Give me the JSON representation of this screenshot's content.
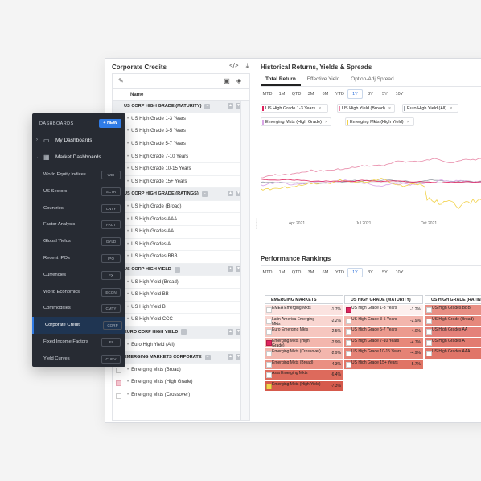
{
  "corporate_credits": {
    "title": "Corporate Credits",
    "column_name": "Name",
    "rows": [
      {
        "type": "group",
        "label": "US CORP HIGH GRADE (MATURITY)"
      },
      {
        "type": "item",
        "label": "US High Grade 1-3 Years"
      },
      {
        "type": "item",
        "label": "US High Grade 3-5 Years"
      },
      {
        "type": "item",
        "label": "US High Grade 5-7 Years"
      },
      {
        "type": "item",
        "label": "US High Grade 7-10 Years"
      },
      {
        "type": "item",
        "label": "US High Grade 10-15 Years"
      },
      {
        "type": "item",
        "label": "US High Grade 15+ Years"
      },
      {
        "type": "group",
        "label": "US CORP HIGH GRADE (RATINGS)"
      },
      {
        "type": "item",
        "label": "US High Grade (Broad)"
      },
      {
        "type": "item",
        "label": "US High Grades AAA"
      },
      {
        "type": "item",
        "label": "US High Grades AA"
      },
      {
        "type": "item",
        "label": "US High Grades A"
      },
      {
        "type": "item",
        "label": "US High Grades BBB"
      },
      {
        "type": "group",
        "label": "US CORP HIGH YIELD"
      },
      {
        "type": "item",
        "label": "US High Yield (Broad)"
      },
      {
        "type": "item",
        "label": "US High Yield BB"
      },
      {
        "type": "item",
        "label": "US High Yield B"
      },
      {
        "type": "item",
        "label": "US High Yield CCC"
      },
      {
        "type": "group",
        "label": "EURO CORP HIGH YIELD"
      },
      {
        "type": "item",
        "label": "Euro High Yield (All)"
      },
      {
        "type": "group",
        "label": "EMERGING MARKETS CORPORATE"
      },
      {
        "type": "item",
        "label": "Emerging Mkts (Broad)"
      },
      {
        "type": "item",
        "label": "Emerging Mkts (High Grade)",
        "checked": true
      },
      {
        "type": "item",
        "label": "Emerging Mkts (Crossover)"
      }
    ]
  },
  "historical": {
    "title": "Historical Returns, Yields & Spreads",
    "tabs": [
      "Total Return",
      "Effective Yield",
      "Option-Adj Spread"
    ],
    "periods": [
      "MTD",
      "1M",
      "QTD",
      "3M",
      "6M",
      "YTD",
      "1Y",
      "3Y",
      "5Y",
      "10Y"
    ],
    "selected_period": "1Y",
    "legend": [
      {
        "label": "US High Grade 1-3 Years",
        "color": "#e0245e"
      },
      {
        "label": "US High Yield (Broad)",
        "color": "#e88aa8"
      },
      {
        "label": "Euro High Yield (All)",
        "color": "#9aa0a8"
      },
      {
        "label": "Emerging Mkts (High Grade)",
        "color": "#d9a6e6"
      },
      {
        "label": "Emerging Mkts (High Yield)",
        "color": "#f2d24b"
      }
    ],
    "x_ticks": [
      "Apr 2021",
      "Jul 2021",
      "Oct 2021"
    ]
  },
  "rankings": {
    "title": "Performance Rankings",
    "periods": [
      "MTD",
      "1M",
      "QTD",
      "3M",
      "6M",
      "YTD",
      "1Y",
      "3Y",
      "5Y",
      "10Y"
    ],
    "selected_period": "1Y",
    "columns": [
      {
        "header": "EMERGING MARKETS",
        "rows": [
          {
            "name": "EMEA Emerging Mkts",
            "value": "-1.7%",
            "color": "#fbe3e0"
          },
          {
            "name": "Latin America Emerging Mkts",
            "value": "-2.2%",
            "color": "#f9d6d1"
          },
          {
            "name": "Euro Emerging Mkts",
            "value": "-2.5%",
            "color": "#f6c6bf"
          },
          {
            "name": "Emerging Mkts (High Grade)",
            "value": "-2.9%",
            "color": "#f3b6ad",
            "checked": true
          },
          {
            "name": "Emerging Mkts (Crossover)",
            "value": "-2.9%",
            "color": "#f3b6ad"
          },
          {
            "name": "Emerging Mkts (Broad)",
            "value": "-4.3%",
            "color": "#ea8f82"
          },
          {
            "name": "Asia Emerging Mkts",
            "value": "-6.4%",
            "color": "#dd6a5c"
          },
          {
            "name": "Emerging Mkts (High Yield)",
            "value": "-7.3%",
            "color": "#d65a4c",
            "checked": true
          }
        ]
      },
      {
        "header": "US HIGH GRADE (MATURITY)",
        "rows": [
          {
            "name": "US High Grade 1-3 Years",
            "value": "-1.2%",
            "color": "#fdf0ee",
            "checked": true
          },
          {
            "name": "US High Grade 3-5 Years",
            "value": "-2.9%",
            "color": "#f3b6ad"
          },
          {
            "name": "US High Grade 5-7 Years",
            "value": "-4.0%",
            "color": "#ec9a8e"
          },
          {
            "name": "US High Grade 7-10 Years",
            "value": "-4.7%",
            "color": "#e78779"
          },
          {
            "name": "US High Grade 10-15 Years",
            "value": "-4.9%",
            "color": "#e58275"
          },
          {
            "name": "US High Grade 15+ Years",
            "value": "-5.7%",
            "color": "#e07465"
          }
        ]
      },
      {
        "header": "US HIGH GRADE (RATINGS)",
        "rows": [
          {
            "name": "US High Grades BBB",
            "value": "",
            "color": "#e88f84"
          },
          {
            "name": "US High Grade (Broad)",
            "value": "",
            "color": "#e6887c"
          },
          {
            "name": "US High Grades AA",
            "value": "",
            "color": "#e4817a"
          },
          {
            "name": "US High Grades A",
            "value": "",
            "color": "#e27b70"
          },
          {
            "name": "US High Grades AAA",
            "value": "",
            "color": "#e07568"
          }
        ]
      }
    ]
  },
  "sidebar": {
    "header": "DASHBOARDS",
    "new_label": "+ NEW",
    "sections": [
      {
        "label": "My Dashboards"
      },
      {
        "label": "Market Dashboards"
      }
    ],
    "items": [
      {
        "label": "World Equity Indices",
        "code": "WEI"
      },
      {
        "label": "US Sectors",
        "code": "SCTR"
      },
      {
        "label": "Countries",
        "code": "CNTY"
      },
      {
        "label": "Factor Analysis",
        "code": "FACT"
      },
      {
        "label": "Global Yields",
        "code": "GYLD"
      },
      {
        "label": "Recent IPOs",
        "code": "IPO"
      },
      {
        "label": "Currencies",
        "code": "FX"
      },
      {
        "label": "World Economics",
        "code": "ECON"
      },
      {
        "label": "Commodities",
        "code": "CMTY"
      },
      {
        "label": "Corporate Credit",
        "code": "CORP",
        "active": true
      },
      {
        "label": "Fixed Income Factors",
        "code": "FI"
      },
      {
        "label": "Yield Curves",
        "code": "CURV"
      }
    ]
  }
}
